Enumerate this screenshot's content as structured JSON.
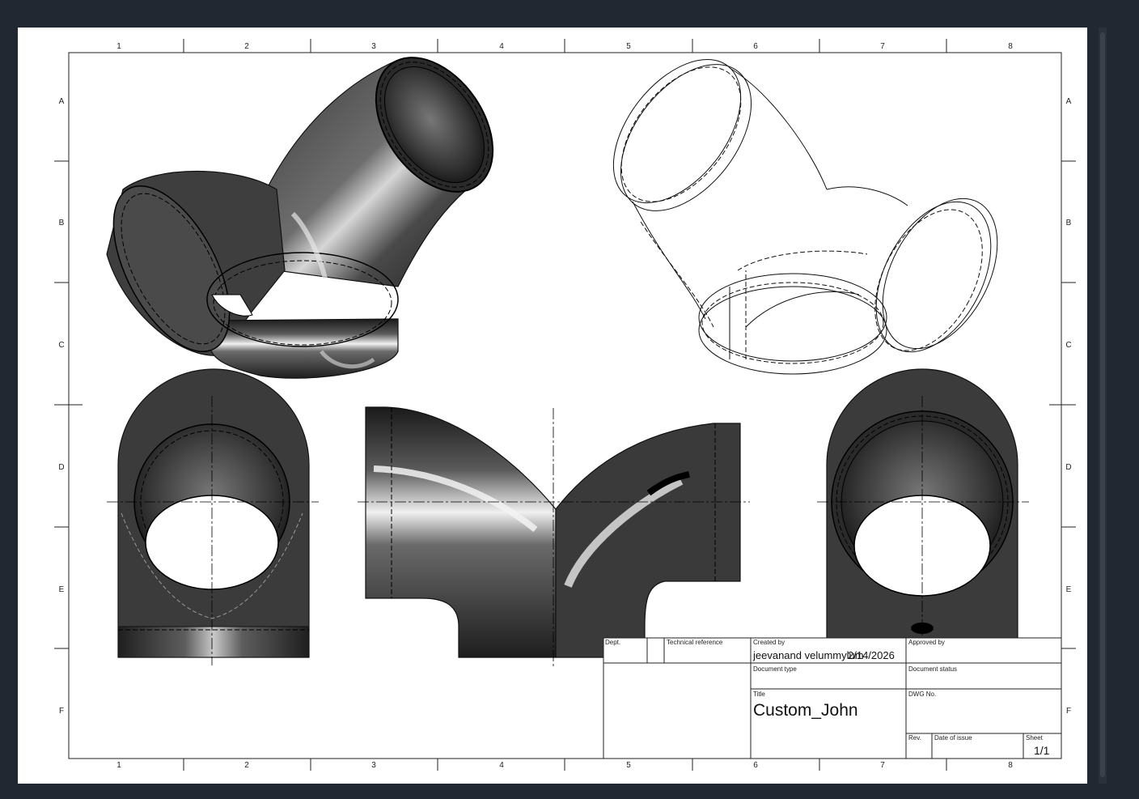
{
  "border": {
    "columns": [
      "1",
      "2",
      "3",
      "4",
      "5",
      "6",
      "7",
      "8"
    ],
    "rows": [
      "A",
      "B",
      "C",
      "D",
      "E",
      "F"
    ]
  },
  "title_block": {
    "dept_label": "Dept.",
    "tech_ref_label": "Technical reference",
    "created_by_label": "Created by",
    "created_by_value": "jeevanand velummylum",
    "created_date": "2/14/2026",
    "approved_by_label": "Approved by",
    "doc_type_label": "Document type",
    "doc_status_label": "Document status",
    "title_label": "Title",
    "title_value": "Custom_John",
    "dwg_no_label": "DWG No.",
    "rev_label": "Rev.",
    "date_of_issue_label": "Date of issue",
    "sheet_label": "Sheet",
    "sheet_value": "1/1"
  },
  "views": [
    "iso-shaded-view",
    "iso-wireframe-view",
    "front-view",
    "side-view",
    "rear-view"
  ]
}
